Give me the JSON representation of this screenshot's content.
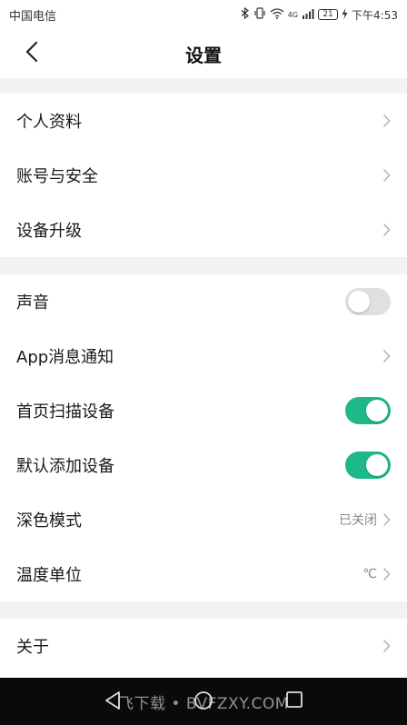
{
  "status_bar": {
    "carrier": "中国电信",
    "network": "4G",
    "battery": "21",
    "time": "下午4:53"
  },
  "header": {
    "title": "设置"
  },
  "groups": [
    {
      "items": [
        {
          "label": "个人资料",
          "control": "chevron"
        },
        {
          "label": "账号与安全",
          "control": "chevron"
        },
        {
          "label": "设备升级",
          "control": "chevron"
        }
      ]
    },
    {
      "items": [
        {
          "label": "声音",
          "control": "toggle",
          "on": false
        },
        {
          "label": "App消息通知",
          "control": "chevron"
        },
        {
          "label": "首页扫描设备",
          "control": "toggle",
          "on": true
        },
        {
          "label": "默认添加设备",
          "control": "toggle",
          "on": true
        },
        {
          "label": "深色模式",
          "control": "chevron",
          "value": "已关闭"
        },
        {
          "label": "温度单位",
          "control": "chevron",
          "value": "℃"
        }
      ]
    },
    {
      "items": [
        {
          "label": "关于",
          "control": "chevron"
        }
      ]
    }
  ],
  "nav_bar": {
    "watermark": "飞下载 • BVFZXY.COM"
  },
  "colors": {
    "accent": "#1fb888",
    "toggle_off": "#e0e0e0",
    "background": "#f2f2f2"
  }
}
